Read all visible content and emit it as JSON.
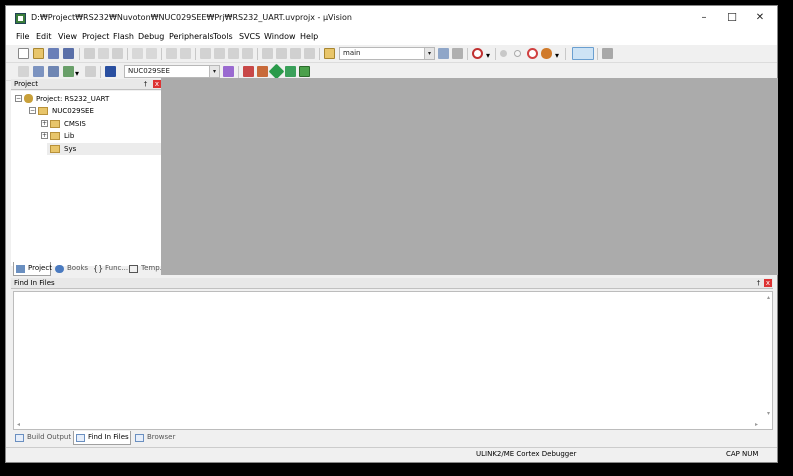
{
  "window": {
    "title": "D:₩Project₩RS232₩Nuvoton₩NUC029SEE₩Prj₩RS232_UART.uvprojx - µVision",
    "minimize": "–",
    "maximize": "☐",
    "close": "✕"
  },
  "menu": [
    "File",
    "Edit",
    "View",
    "Project",
    "Flash",
    "Debug",
    "Peripherals",
    "Tools",
    "SVCS",
    "Window",
    "Help"
  ],
  "toolbar": {
    "find_combo_value": "main",
    "target_combo_value": "NUC029SEE"
  },
  "project_panel": {
    "header": "Project",
    "pin": "†",
    "close": "x",
    "tree": {
      "root": "Project: RS232_UART",
      "target": "NUC029SEE",
      "groups": [
        "CMSIS",
        "Lib",
        "Sys"
      ]
    },
    "tabs": [
      "Project",
      "Books",
      "Func...",
      "Temp..."
    ]
  },
  "find_panel": {
    "header": "Find In Files",
    "pin": "†",
    "close": "x",
    "tabs": [
      "Build Output",
      "Find In Files",
      "Browser"
    ]
  },
  "status": {
    "debugger": "ULINK2/ME Cortex Debugger",
    "cap": "CAP",
    "num": "NUM"
  },
  "colors": {
    "editor_bg": "#ababab",
    "window_bg": "#f0f0f0",
    "close_red": "#dd3333"
  }
}
